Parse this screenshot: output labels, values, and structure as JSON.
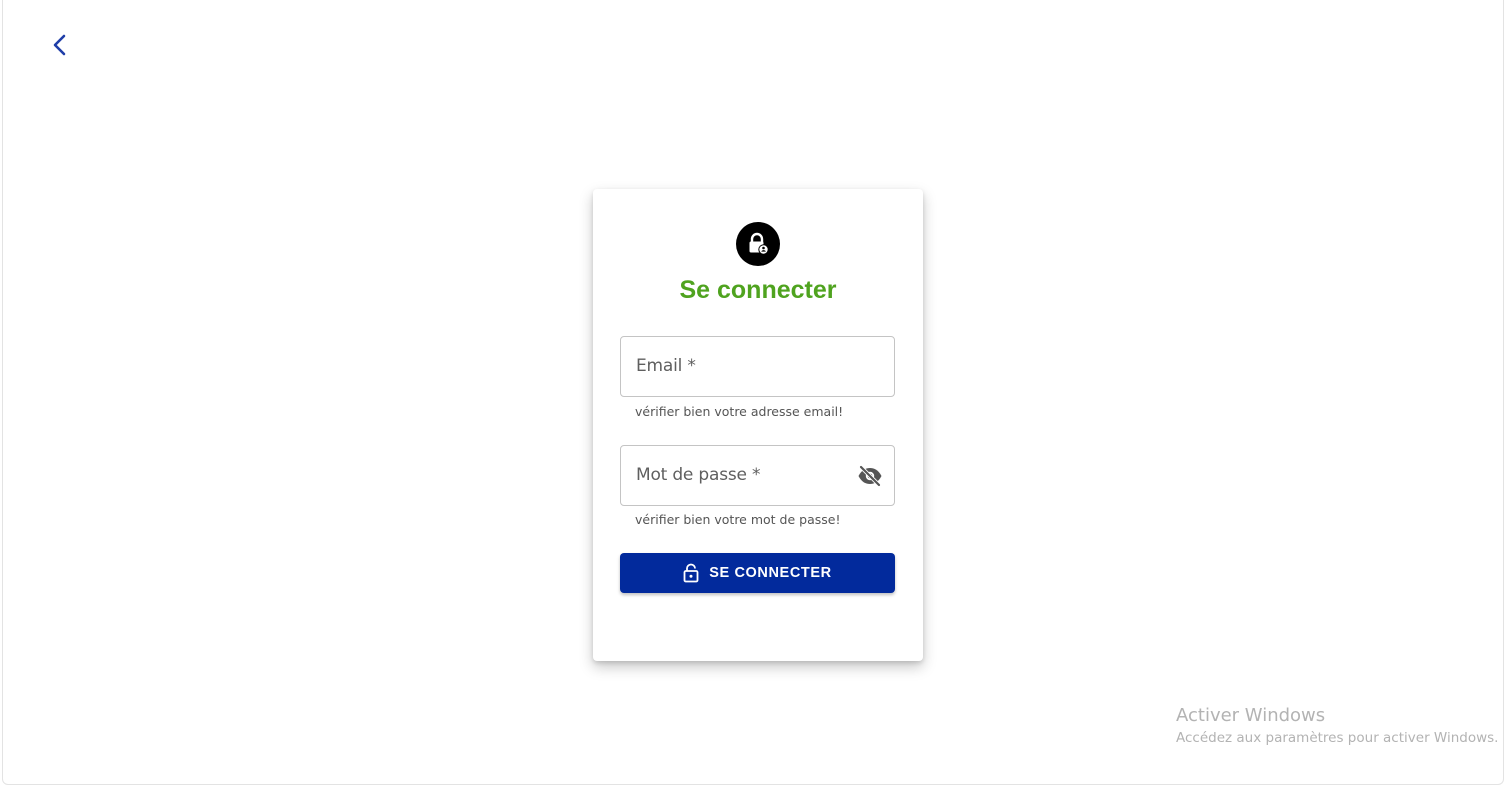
{
  "colors": {
    "accent_blue": "#022a9c",
    "title_green": "#4fa31f",
    "back_arrow": "#1f3ea8"
  },
  "back_button": {
    "icon": "chevron-left-icon"
  },
  "card": {
    "icon": "lock-person-icon",
    "title": "Se connecter"
  },
  "form": {
    "email": {
      "label": "Email *",
      "value": "",
      "helper": "vérifier bien votre adresse email!"
    },
    "password": {
      "label": "Mot de passe *",
      "value": "",
      "helper": "vérifier bien votre mot de passe!",
      "toggle_icon": "eye-off-icon"
    },
    "submit": {
      "label": "SE CONNECTER",
      "icon": "lock-open-icon"
    }
  },
  "watermark": {
    "title": "Activer Windows",
    "subtitle": "Accédez aux paramètres pour activer Windows."
  }
}
